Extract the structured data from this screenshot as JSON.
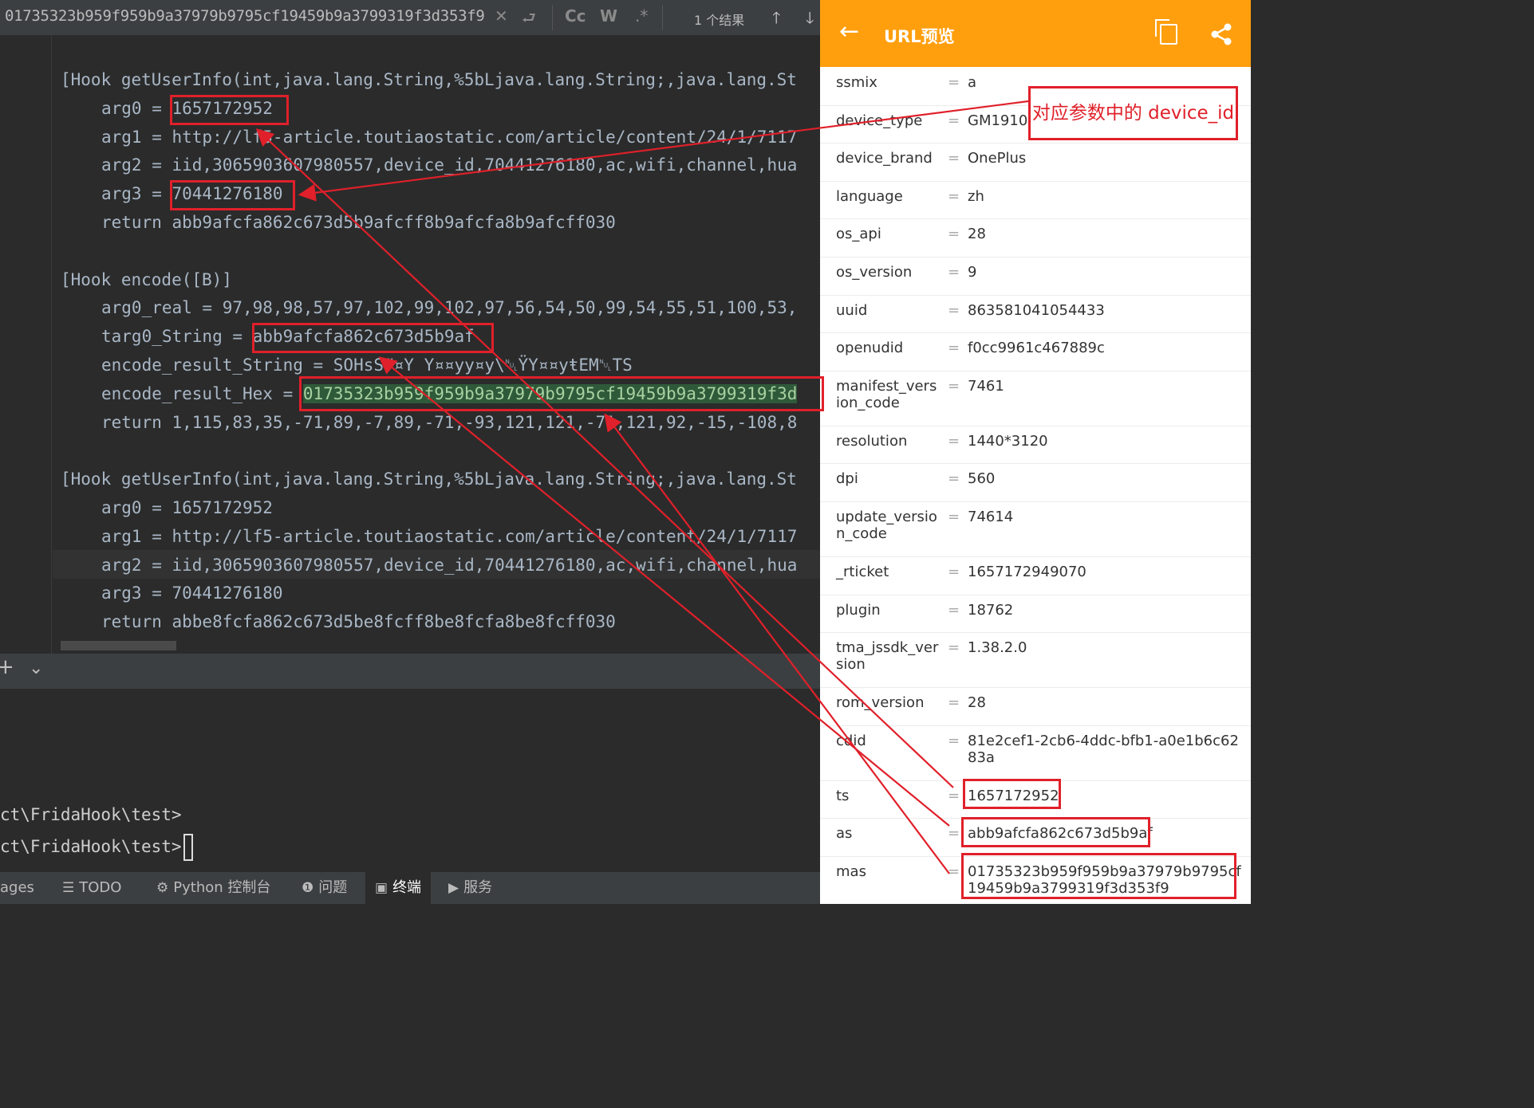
{
  "findbar": {
    "query": "01735323b959f959b9a37979b9795cf19459b9a3799319f3d353f9",
    "result_count": "1 个结果"
  },
  "editor": {
    "lines": [
      "[Hook getUserInfo(int,java.lang.String,%5bLjava.lang.String;,java.lang.St",
      "arg0 = 1657172952",
      "arg1 = http://lf5-article.toutiaostatic.com/article/content/24/1/7117",
      "arg2 = iid,3065903607980557,device_id,70441276180,ac,wifi,channel,hua",
      "arg3 = 70441276180",
      "return abb9afcfa862c673d5b9afcff8b9afcfa8b9afcff030",
      "",
      "[Hook encode([B)]",
      "arg0_real = 97,98,98,57,97,102,99,102,97,56,54,50,99,54,55,51,100,53,",
      "targ0_String = abb9afcfa862c673d5b9af",
      "encode_result_String = SOHsS#¤Y Y¤¤yy¤y\\␀ŸY¤¤yŧEM␀TS",
      "encode_result_Hex = 01735323b959f959b9a37979b9795cf19459b9a3799319f3d",
      "return 1,115,83,35,-71,89,-7,89,-71,-93,121,121,-71,121,92,-15,-108,8",
      "",
      "[Hook getUserInfo(int,java.lang.String,%5bLjava.lang.String;,java.lang.St",
      "arg0 = 1657172952",
      "arg1 = http://lf5-article.toutiaostatic.com/article/content/24/1/7117",
      "arg2 = iid,3065903607980557,device_id,70441276180,ac,wifi,channel,hua",
      "arg3 = 70441276180",
      "return abbe8fcfa862c673d5be8fcff8be8fcfa8be8fcff030"
    ]
  },
  "terminal": {
    "lines": [
      "ct\\FridaHook\\test>",
      "ct\\FridaHook\\test>"
    ]
  },
  "statusbar": {
    "items": [
      "ages",
      "TODO",
      "Python 控制台",
      "问题",
      "终端",
      "服务"
    ]
  },
  "phone": {
    "title": "URL预览",
    "params": [
      {
        "key": "ssmix",
        "value": "a"
      },
      {
        "key": "device_type",
        "value": "GM1910"
      },
      {
        "key": "device_brand",
        "value": "OnePlus"
      },
      {
        "key": "language",
        "value": "zh"
      },
      {
        "key": "os_api",
        "value": "28"
      },
      {
        "key": "os_version",
        "value": "9"
      },
      {
        "key": "uuid",
        "value": "863581041054433"
      },
      {
        "key": "openudid",
        "value": "f0cc9961c467889c"
      },
      {
        "key": "manifest_version_code",
        "value": "7461"
      },
      {
        "key": "resolution",
        "value": "1440*3120"
      },
      {
        "key": "dpi",
        "value": "560"
      },
      {
        "key": "update_version_code",
        "value": "74614"
      },
      {
        "key": "_rticket",
        "value": "1657172949070"
      },
      {
        "key": "plugin",
        "value": "18762"
      },
      {
        "key": "tma_jssdk_version",
        "value": "1.38.2.0"
      },
      {
        "key": "rom_version",
        "value": "28"
      },
      {
        "key": "cdid",
        "value": "81e2cef1-2cb6-4ddc-bfb1-a0e1b6c6283a"
      },
      {
        "key": "ts",
        "value": "1657172952"
      },
      {
        "key": "as",
        "value": "abb9afcfa862c673d5b9af"
      },
      {
        "key": "mas",
        "value": "01735323b959f959b9a37979b9795cf19459b9a3799319f3d353f9"
      }
    ]
  },
  "annotation": {
    "label": "对应参数中的 device_id"
  },
  "colors": {
    "accent": "#ff9f0e",
    "annotation": "#e0202a",
    "ide_bg": "#2b2b2b"
  }
}
